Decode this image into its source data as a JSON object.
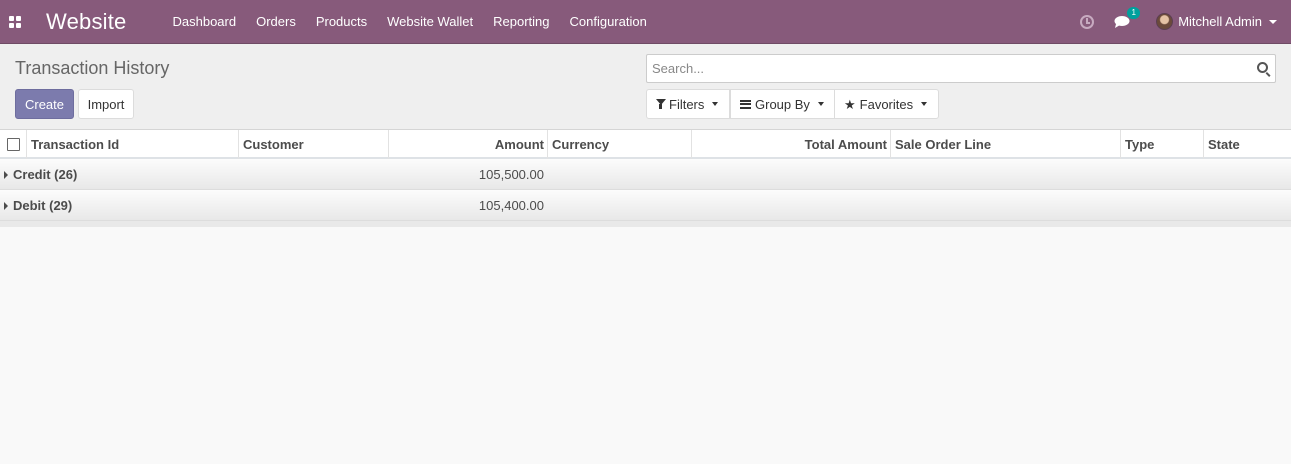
{
  "navbar": {
    "brand": "Website",
    "menu": [
      "Dashboard",
      "Orders",
      "Products",
      "Website Wallet",
      "Reporting",
      "Configuration"
    ],
    "chat_badge": "1",
    "user_name": "Mitchell Admin",
    "color": "#875a7b"
  },
  "control_panel": {
    "title": "Transaction History",
    "create_label": "Create",
    "import_label": "Import",
    "search_placeholder": "Search...",
    "filters_label": "Filters",
    "group_by_label": "Group By",
    "favorites_label": "Favorites"
  },
  "table": {
    "columns": [
      "Transaction Id",
      "Customer",
      "Amount",
      "Currency",
      "Total Amount",
      "Sale Order Line",
      "Type",
      "State"
    ],
    "groups": [
      {
        "label": "Credit (26)",
        "amount": "105,500.00"
      },
      {
        "label": "Debit (29)",
        "amount": "105,400.00"
      }
    ]
  },
  "icons": [
    "apps-icon",
    "clock-icon",
    "chat-icon",
    "search-icon",
    "funnel-icon",
    "bars-icon",
    "star-icon"
  ]
}
